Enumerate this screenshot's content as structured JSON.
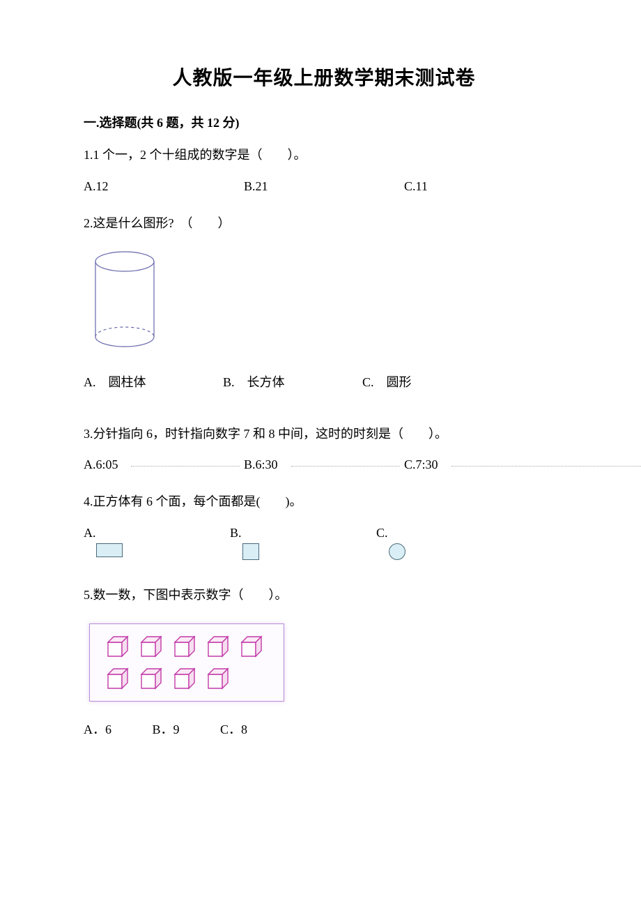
{
  "title": "人教版一年级上册数学期末测试卷",
  "section1": {
    "header": "一.选择题(共 6 题，共 12 分)"
  },
  "q1": {
    "text": "1.1 个一，2 个十组成的数字是（　　）。",
    "opts": {
      "a": "A.12",
      "b": "B.21",
      "c": "C.11"
    }
  },
  "q2": {
    "text": "2.这是什么图形?　（　　）",
    "opts": {
      "a": "A.　圆柱体",
      "b": "B.　长方体",
      "c": "C.　圆形"
    }
  },
  "q3": {
    "text": "3.分针指向 6，时针指向数字 7 和 8 中间，这时的时刻是（　　）。",
    "opts": {
      "a": "A.6:05",
      "b": "B.6:30",
      "c": "C.7:30"
    }
  },
  "q4": {
    "text": "4.正方体有 6 个面，每个面都是(　　)。",
    "opts": {
      "a": "A.",
      "b": "B.",
      "c": "C."
    }
  },
  "q5": {
    "text": "5.数一数，下图中表示数字（　　）。",
    "opts": {
      "a": "A．6",
      "b": "B．9",
      "c": "C．8"
    }
  },
  "chart_data": {
    "type": "table",
    "title": "q5 cube count",
    "rows": [
      5,
      4
    ],
    "total": 9
  }
}
